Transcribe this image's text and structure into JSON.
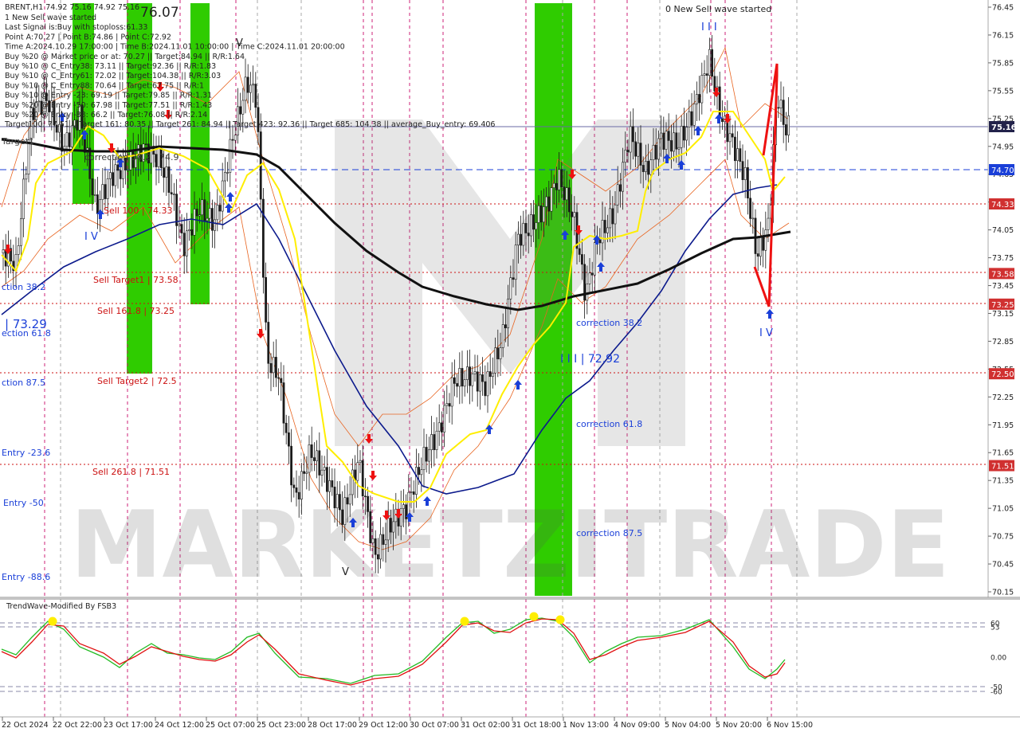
{
  "header": {
    "symbol_line": "BRENT,H1  74.92 75.16 74.92 75.16",
    "big_value": "76.07",
    "info_lines": [
      "1 New Sell wave started",
      "Last Signal is:Buy with stoploss:61.33",
      "Point A:70.27 | Point B:74.86 | Point C:72.92",
      "Time A:2024.10.29 17:00:00 | Time B:2024.11.01 10:00:00 | Time C:2024.11.01 20:00:00",
      "Buy %20 @ Market price or at: 70.27 || Target:84.94 || R/R:1.64",
      "Buy %10 @ C_Entry38: 73.11 || Target:92.36 || R/R:1.83",
      "Buy %10 @ C_Entry61: 72.02 || Target:104.38 || R/R:3.03",
      "Buy %10 @ C_Entry88: 70.64 || Target:67.75 || R/R:1",
      "Buy %10 @ Entry -23: 69.19 || Target:79.85 || R/R:1.31",
      "Buy %20 @ Entry -50: 67.98 || Target:77.51 || R/R:1.43",
      "Buy %20 @ Entry -88: 66.2 || Target:76.08 || R/R:2.14",
      "Target100: 77.51 || Target 161: 80.35 || Target 261: 84.94 || Target 423: 92.36 || Target 685: 104.38 || average_Buy_entry: 69.406"
    ],
    "top_note": "0 New Sell wave started"
  },
  "watermark": "MARKETZITRADE",
  "price_axis": {
    "ticks": [
      "76.45",
      "76.15",
      "75.85",
      "75.55",
      "75.25",
      "74.95",
      "74.65",
      "74.35",
      "74.05",
      "73.75",
      "73.45",
      "73.15",
      "72.85",
      "72.55",
      "72.25",
      "71.95",
      "71.65",
      "71.35",
      "71.05",
      "70.75",
      "70.45",
      "70.15"
    ],
    "current_price": "75.16",
    "blue_level": "74.70",
    "red_levels": [
      "74.33",
      "73.58",
      "73.25",
      "72.50",
      "71.51"
    ]
  },
  "time_axis": {
    "labels": [
      "22 Oct 2024",
      "22 Oct 22:00",
      "23 Oct 17:00",
      "24 Oct 12:00",
      "25 Oct 07:00",
      "25 Oct 23:00",
      "28 Oct 17:00",
      "29 Oct 12:00",
      "30 Oct 07:00",
      "31 Oct 02:00",
      "31 Oct 18:00",
      "1 Nov 13:00",
      "4 Nov 09:00",
      "5 Nov 04:00",
      "5 Nov 20:00",
      "6 Nov 15:00"
    ]
  },
  "annotations": {
    "target1": "Target1",
    "sell_100": "Sell 100 | 74.33",
    "correction_38_top": "correction 38.2 | 74.9",
    "sell_target1": "Sell Target1 | 73.58",
    "sell_161": "Sell 161.8 | 73.25",
    "sell_target2": "Sell Target2 | 72.5",
    "sell_261": "Sell  261.8 | 71.51",
    "left_38": "ction 38.2",
    "left_7329": "| 73.29",
    "left_618": "ection 61.8",
    "left_875": "ction 87.5",
    "entry_236": "Entry -23.6",
    "entry_50": "Entry -50",
    "entry_886": "Entry -88.6",
    "corr_382": "correction 38.2",
    "corr_618": "correction 61.8",
    "corr_875": "correction 87.5",
    "wave_7292": "I I I | 72.92",
    "wave_iv_left": "I V",
    "wave_iv_right": "I V",
    "wave_iii_top": "I I I",
    "wave_v_top": "V",
    "wave_v_bottom": "V"
  },
  "indicator": {
    "title": "TrendWave-Modified By FSB3",
    "ticks": [
      "60",
      "53",
      "0.00",
      "-50",
      "-60"
    ]
  },
  "chart_data": {
    "type": "line",
    "title": "BRENT,H1",
    "series": [
      {
        "name": "BRENT,H1",
        "x": [
          "22 Oct 2024",
          "22 Oct 22:00",
          "23 Oct 17:00",
          "24 Oct 12:00",
          "25 Oct 07:00",
          "25 Oct 23:00",
          "28 Oct 17:00",
          "29 Oct 12:00",
          "30 Oct 07:00",
          "31 Oct 02:00",
          "31 Oct 18:00",
          "1 Nov 13:00",
          "4 Nov 09:00",
          "5 Nov 04:00",
          "5 Nov 20:00",
          "6 Nov 15:00"
        ],
        "values": [
          73.8,
          75.4,
          74.5,
          74.2,
          75.3,
          72.6,
          71.1,
          70.6,
          71.3,
          72.3,
          74.2,
          73.2,
          74.9,
          75.0,
          75.6,
          75.16
        ]
      }
    ],
    "ylim": [
      70.1,
      76.5
    ],
    "grid": false
  },
  "colors": {
    "green_zone": "#2fcc00",
    "blue_line": "#0c1a8c",
    "black_ma": "#111111",
    "yellow_line": "#ffee00",
    "red_level": "#cc1111",
    "price_box": "#22224a",
    "blue_box": "#1a3fd8",
    "red_box": "#d03030",
    "magenta_vline": "#cc2277",
    "osc_red": "#e01010",
    "osc_green": "#22bb22"
  }
}
